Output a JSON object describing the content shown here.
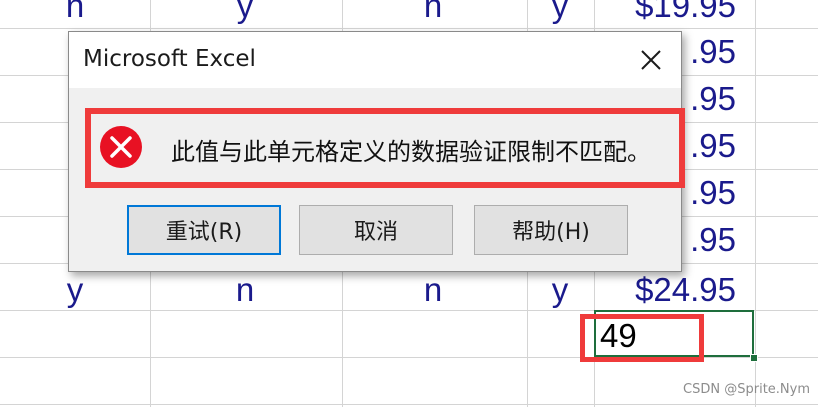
{
  "sheet": {
    "rows": [
      {
        "c1": "n",
        "c2": "y",
        "c3": "n",
        "c4": "y",
        "price": "$19.95"
      },
      {
        "c1": "",
        "c2": "",
        "c3": "",
        "c4": "",
        "price": ".95"
      },
      {
        "c1": "",
        "c2": "",
        "c3": "",
        "c4": "",
        "price": ".95"
      },
      {
        "c1": "",
        "c2": "",
        "c3": "",
        "c4": "",
        "price": ".95"
      },
      {
        "c1": "",
        "c2": "",
        "c3": "",
        "c4": "",
        "price": ".95"
      },
      {
        "c1": "",
        "c2": "",
        "c3": "",
        "c4": "",
        "price": ".95"
      },
      {
        "c1": "y",
        "c2": "n",
        "c3": "n",
        "c4": "y",
        "price": "$24.95"
      }
    ],
    "entry_value": "49",
    "text_color": "#1a1a8c",
    "selection_color": "#1e6e3c"
  },
  "dialog": {
    "title": "Microsoft Excel",
    "close_icon": "close-icon",
    "message": "此值与此单元格定义的数据验证限制不匹配。",
    "icon": "error-icon",
    "buttons": {
      "retry": "重试(R)",
      "cancel": "取消",
      "help": "帮助(H)"
    }
  },
  "annotation_color": "#ef3b3b",
  "watermark": "CSDN @Sprite.Nym"
}
